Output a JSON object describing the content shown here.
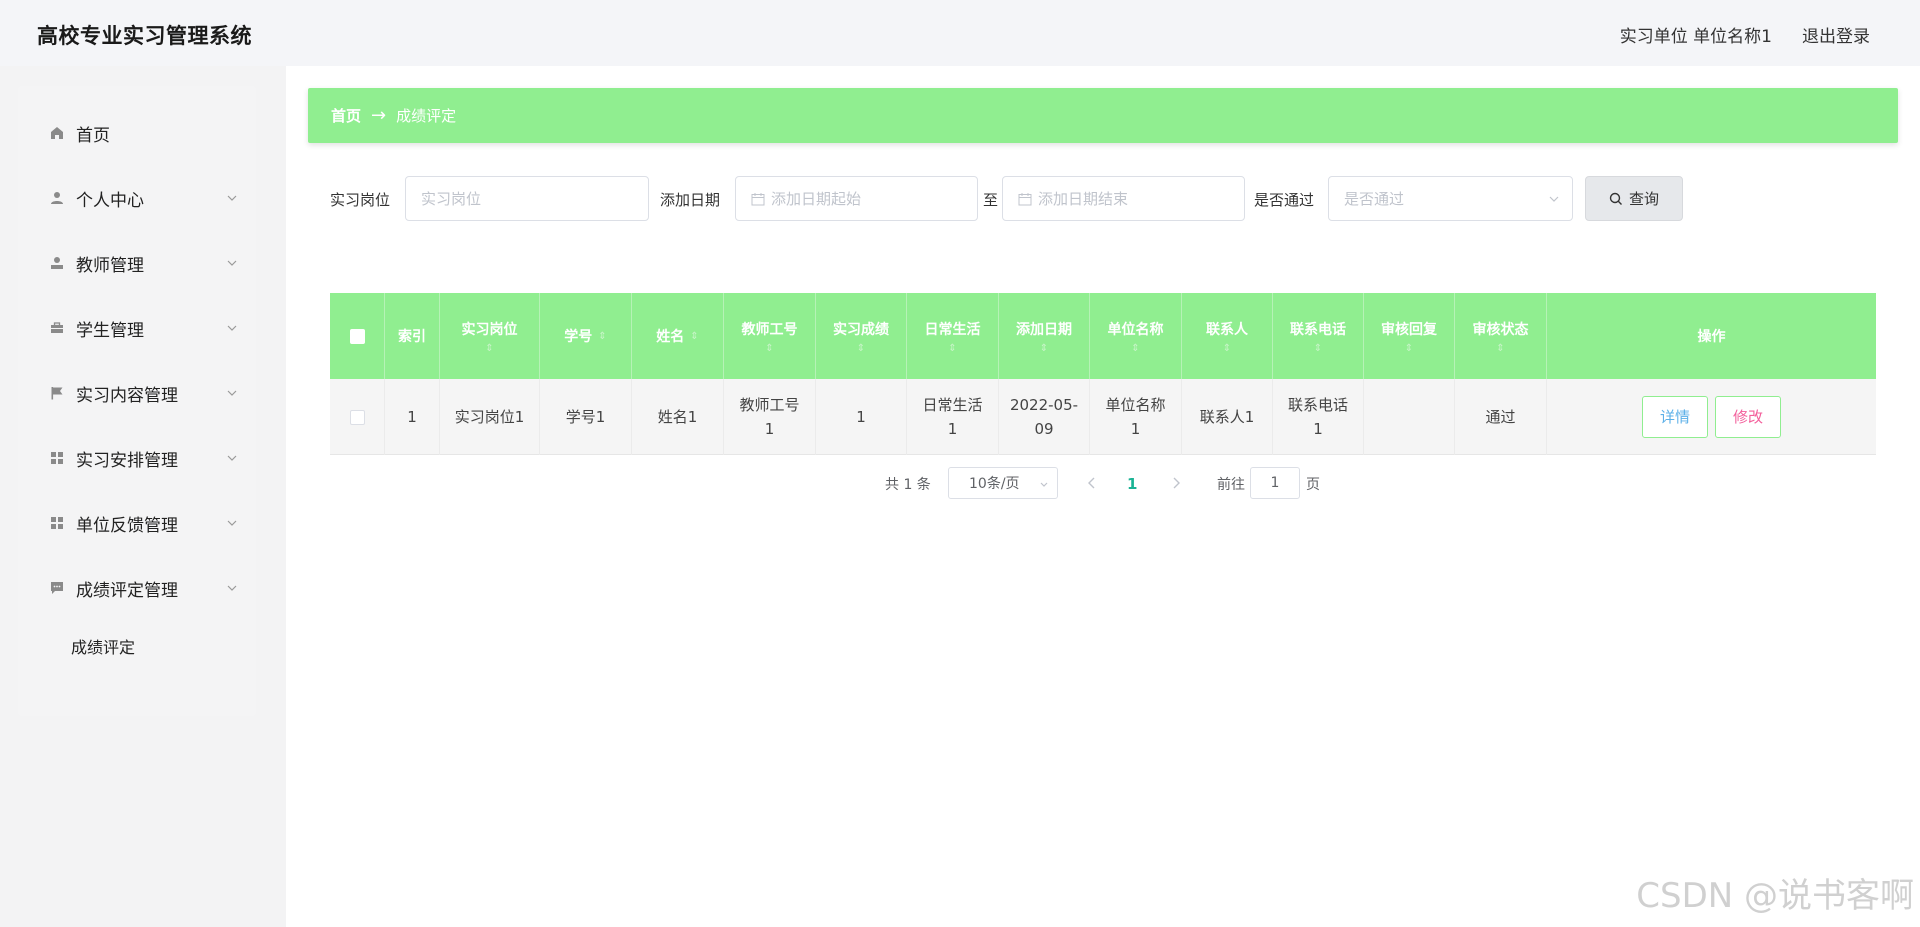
{
  "app": {
    "title": "高校专业实习管理系统",
    "user_info": "实习单位 单位名称1",
    "logout_label": "退出登录"
  },
  "sidebar": {
    "items": [
      {
        "label": "首页",
        "icon": "home-icon"
      },
      {
        "label": "个人中心",
        "icon": "user-icon"
      },
      {
        "label": "教师管理",
        "icon": "teacher-icon"
      },
      {
        "label": "学生管理",
        "icon": "briefcase-icon"
      },
      {
        "label": "实习内容管理",
        "icon": "flag-icon"
      },
      {
        "label": "实习安排管理",
        "icon": "grid-icon"
      },
      {
        "label": "单位反馈管理",
        "icon": "grid-icon"
      },
      {
        "label": "成绩评定管理",
        "icon": "chat-icon"
      }
    ],
    "subitem": "成绩评定"
  },
  "breadcrumb": {
    "home": "首页",
    "separator": "→",
    "current": "成绩评定"
  },
  "search": {
    "position_label": "实习岗位",
    "position_placeholder": "实习岗位",
    "date_label": "添加日期",
    "date_start_placeholder": "添加日期起始",
    "date_to": "至",
    "date_end_placeholder": "添加日期结束",
    "passed_label": "是否通过",
    "passed_placeholder": "是否通过",
    "query_label": "查询"
  },
  "table": {
    "headers": [
      "索引",
      "实习岗位",
      "学号",
      "姓名",
      "教师工号",
      "实习成绩",
      "日常生活",
      "添加日期",
      "单位名称",
      "联系人",
      "联系电话",
      "审核回复",
      "审核状态",
      "操作"
    ],
    "sort_glyph": "⇕",
    "rows": [
      {
        "index": "1",
        "position": "实习岗位1",
        "student_no": "学号1",
        "name": "姓名1",
        "teacher_no_l1": "教师工号",
        "teacher_no_l2": "1",
        "score": "1",
        "daily_l1": "日常生活",
        "daily_l2": "1",
        "date_l1": "2022-05-",
        "date_l2": "09",
        "unit_l1": "单位名称",
        "unit_l2": "1",
        "contact": "联系人1",
        "phone_l1": "联系电话",
        "phone_l2": "1",
        "reply": "",
        "status": "通过",
        "detail_label": "详情",
        "edit_label": "修改"
      }
    ]
  },
  "pagination": {
    "total": "共 1 条",
    "page_size": "10条/页",
    "current_page": "1",
    "goto_label": "前往",
    "goto_value": "1",
    "page_suffix": "页"
  },
  "watermark": "CSDN @说书客啊",
  "colors": {
    "accent_green": "#90ee90",
    "detail_text": "#5cb0e8",
    "edit_text": "#f35f9b",
    "page_active": "#1ab394"
  }
}
